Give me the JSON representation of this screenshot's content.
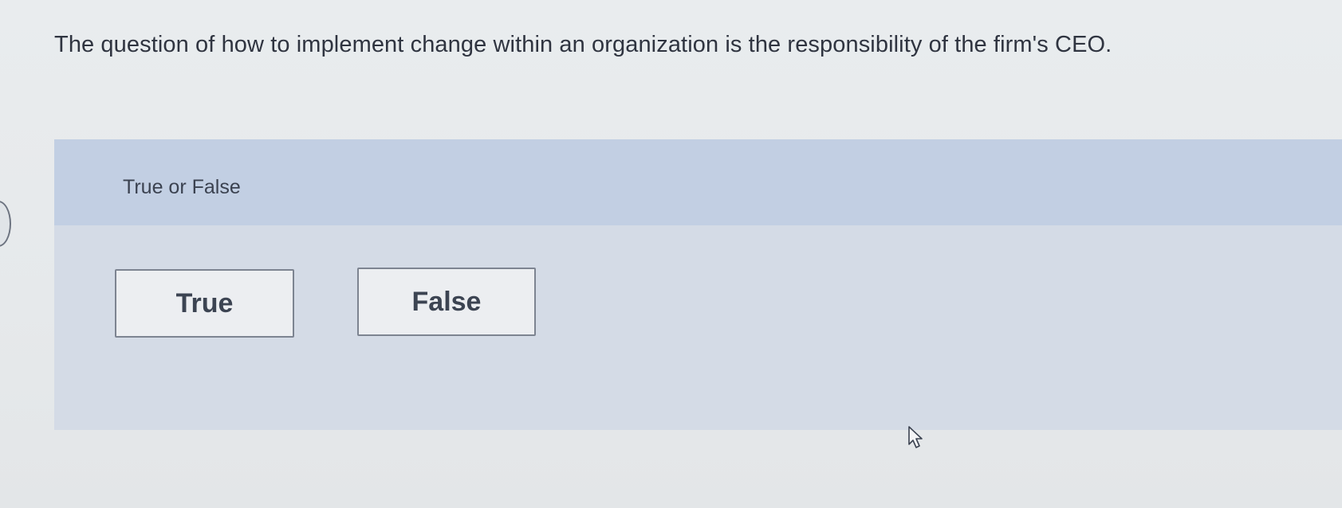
{
  "question": {
    "text": "The question of how to implement change within an organization is the responsibility of the firm's CEO."
  },
  "answer_panel": {
    "prompt": "True or False",
    "choices": [
      {
        "label": "True"
      },
      {
        "label": "False"
      }
    ]
  },
  "colors": {
    "page_background": "#e8ebed",
    "panel_header": "#c2cfe3",
    "panel_body": "#d4dbe6",
    "button_border": "#7d8491"
  },
  "icons": {
    "cursor": "arrow-cursor-icon"
  }
}
